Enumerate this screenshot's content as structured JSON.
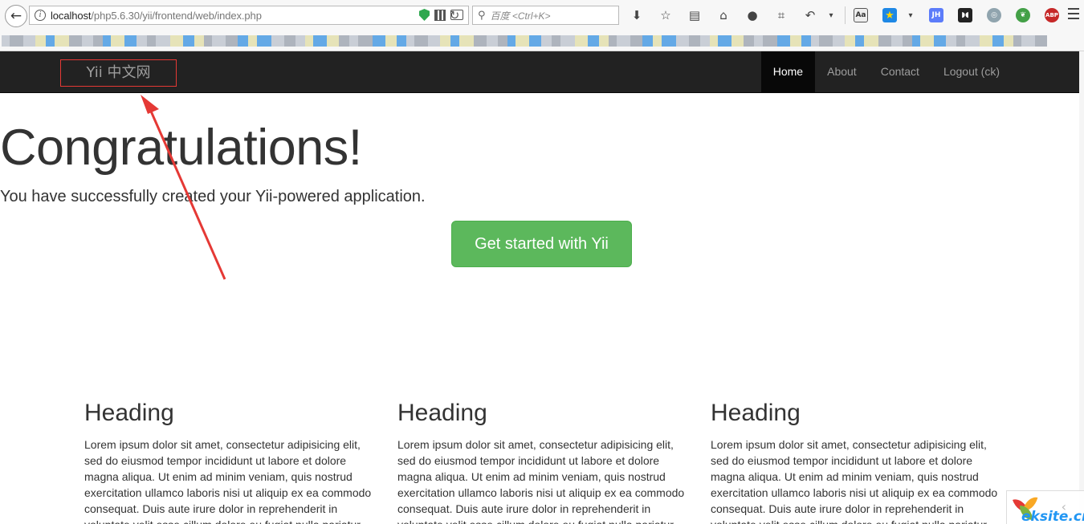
{
  "browser": {
    "url_host": "localhost",
    "url_path": "/php5.6.30/yii/frontend/web/index.php",
    "search_placeholder": "百度 <Ctrl+K>",
    "badges": {
      "jh": "JH",
      "abp": "ABP"
    },
    "icons": [
      "download-icon",
      "star-icon",
      "reading-list-icon",
      "home-icon",
      "chat-icon",
      "crop-icon",
      "undo-icon",
      "dropdown-icon",
      "screenshot-icon",
      "star-badge-icon",
      "dropdown-icon",
      "jh-icon",
      "ghost-icon",
      "globe-icon",
      "leaf-icon",
      "abp-icon"
    ]
  },
  "navbar": {
    "brand": "Yii 中文网",
    "items": [
      {
        "label": "Home",
        "active": true
      },
      {
        "label": "About",
        "active": false
      },
      {
        "label": "Contact",
        "active": false
      },
      {
        "label": "Logout (ck)",
        "active": false
      }
    ]
  },
  "jumbotron": {
    "title": "Congratulations!",
    "lead": "You have successfully created your Yii-powered application.",
    "cta": "Get started with Yii"
  },
  "columns": [
    {
      "heading": "Heading",
      "text": "Lorem ipsum dolor sit amet, consectetur adipisicing elit, sed do eiusmod tempor incididunt ut labore et dolore magna aliqua. Ut enim ad minim veniam, quis nostrud exercitation ullamco laboris nisi ut aliquip ex ea commodo consequat. Duis aute irure dolor in reprehenderit in voluptate velit esse cillum dolore eu fugiat nulla pariatur."
    },
    {
      "heading": "Heading",
      "text": "Lorem ipsum dolor sit amet, consectetur adipisicing elit, sed do eiusmod tempor incididunt ut labore et dolore magna aliqua. Ut enim ad minim veniam, quis nostrud exercitation ullamco laboris nisi ut aliquip ex ea commodo consequat. Duis aute irure dolor in reprehenderit in voluptate velit esse cillum dolore eu fugiat nulla pariatur."
    },
    {
      "heading": "Heading",
      "text": "Lorem ipsum dolor sit amet, consectetur adipisicing elit, sed do eiusmod tempor incididunt ut labore et dolore magna aliqua. Ut enim ad minim veniam, quis nostrud exercitation ullamco laboris nisi ut aliquip ex ea commodo consequat. Duis aute irure dolor in reprehenderit in voluptate velit esse cillum dolore eu fugiat nulla pariatur."
    }
  ],
  "watermark": "eksite.cn",
  "colors": {
    "navbar_bg": "#222222",
    "nav_active_bg": "#080808",
    "cta_green": "#5cb85c",
    "annotation_red": "#e53935"
  }
}
